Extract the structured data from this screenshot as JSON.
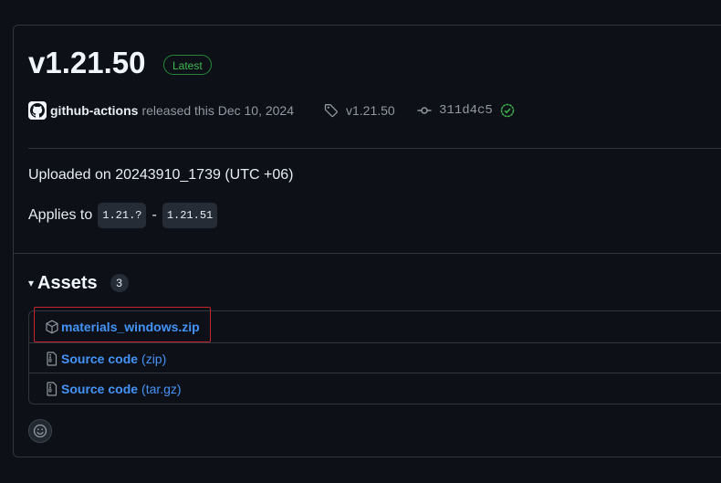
{
  "release": {
    "title": "v1.21.50",
    "latest_badge": "Latest",
    "author": "github-actions",
    "released_text": "released this Dec 10, 2024",
    "tag": "v1.21.50",
    "commit": "311d4c5"
  },
  "body": {
    "uploaded": "Uploaded on 20243910_1739 (UTC +06)",
    "applies_prefix": "Applies to",
    "version_from": "1.21.?",
    "separator": "-",
    "version_to": "1.21.51"
  },
  "assets": {
    "caret": "▾",
    "title": "Assets",
    "count": "3",
    "items": [
      {
        "name": "materials_windows.zip",
        "suffix": "",
        "icon": "package-icon"
      },
      {
        "name": "Source code",
        "suffix": "(zip)",
        "icon": "file-zip-icon"
      },
      {
        "name": "Source code",
        "suffix": "(tar.gz)",
        "icon": "file-zip-icon"
      }
    ]
  },
  "colors": {
    "background": "#0d1117",
    "border": "#30363d",
    "link": "#4493f8",
    "latest_green": "#3fb950",
    "highlight_red": "#c0272d"
  }
}
